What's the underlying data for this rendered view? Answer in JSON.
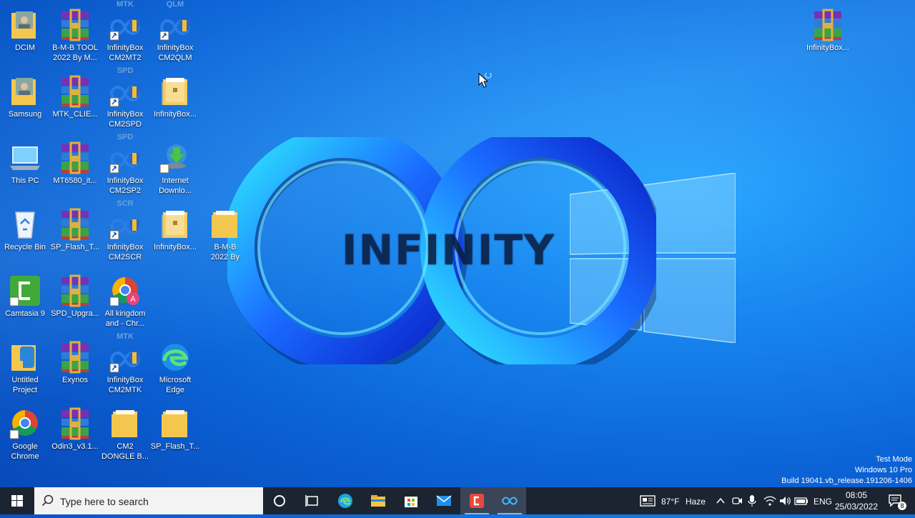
{
  "desktop": {
    "icons": [
      {
        "label": "DCIM",
        "type": "folder-photo"
      },
      {
        "label": "B-M-B TOOL\n2022 By M...",
        "type": "winrar"
      },
      {
        "label": "InfinityBox\nCM2MT2",
        "type": "infinity-shortcut",
        "badge": "MTK"
      },
      {
        "label": "InfinityBox\nCM2QLM",
        "type": "infinity-shortcut",
        "badge": "QLM"
      },
      {
        "label": "Samsung",
        "type": "folder-photo"
      },
      {
        "label": "MTK_CLIE...",
        "type": "winrar"
      },
      {
        "label": "InfinityBox\nCM2SPD",
        "type": "infinity-shortcut",
        "badge": "SPD"
      },
      {
        "label": "InfinityBox...",
        "type": "folder-doc"
      },
      {
        "label": "This PC",
        "type": "this-pc"
      },
      {
        "label": "MT6580_it...",
        "type": "winrar"
      },
      {
        "label": "InfinityBox\nCM2SP2",
        "type": "infinity-shortcut",
        "badge": "SPD"
      },
      {
        "label": "Internet\nDownlo...",
        "type": "idm"
      },
      {
        "label": "Recycle Bin",
        "type": "recycle-bin"
      },
      {
        "label": "SP_Flash_T...",
        "type": "winrar"
      },
      {
        "label": "InfinityBox\nCM2SCR",
        "type": "infinity-shortcut",
        "badge": "SCR"
      },
      {
        "label": "InfinityBox...",
        "type": "folder-doc"
      },
      {
        "label": "B-M-B\n2022 By",
        "type": "folder"
      },
      {
        "label": "Camtasia 9",
        "type": "camtasia"
      },
      {
        "label": "SPD_Upgra...",
        "type": "winrar"
      },
      {
        "label": "All kingdom\nand - Chr...",
        "type": "chrome-profile"
      },
      {
        "label": "Untitled\nProject",
        "type": "folder-project"
      },
      {
        "label": "Exynos",
        "type": "winrar"
      },
      {
        "label": "InfinityBox\nCM2MTK",
        "type": "infinity-shortcut",
        "badge": "MTK"
      },
      {
        "label": "Microsoft\nEdge",
        "type": "edge"
      },
      {
        "label": "Google\nChrome",
        "type": "chrome"
      },
      {
        "label": "Odin3_v3.1...",
        "type": "winrar"
      },
      {
        "label": "CM2\nDONGLE B...",
        "type": "folder"
      },
      {
        "label": "SP_Flash_T...",
        "type": "folder"
      },
      {
        "label": "InfinityBox...",
        "type": "winrar"
      }
    ],
    "wallpaper_text": "INFINITY",
    "watermark": {
      "line1": "Test Mode",
      "line2": "Windows 10 Pro",
      "line3": "Build 19041.vb_release.191206-1406"
    }
  },
  "taskbar": {
    "search_placeholder": "Type here to search",
    "apps": [
      "cortana-icon",
      "task-view-icon",
      "edge-icon",
      "file-explorer-icon",
      "store-icon",
      "mail-icon",
      "camtasia-icon",
      "infinity-app-icon"
    ],
    "weather": {
      "temp": "87°F",
      "condition": "Haze"
    },
    "language": "ENG",
    "time": "08:05",
    "date": "25/03/2022",
    "notifications": "8"
  }
}
